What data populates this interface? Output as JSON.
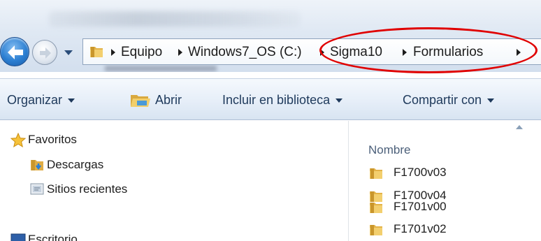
{
  "address_bar": {
    "crumbs": [
      "Equipo",
      "Windows7_OS (C:)",
      "Sigma10",
      "Formularios"
    ]
  },
  "toolbar": {
    "organize_label": "Organizar",
    "open_label": "Abrir",
    "include_label": "Incluir en biblioteca",
    "share_label": "Compartir con"
  },
  "nav_pane": {
    "favorites_label": "Favoritos",
    "items": [
      {
        "label": "Descargas",
        "icon": "downloads-icon"
      },
      {
        "label": "Sitios recientes",
        "icon": "recent-places-icon"
      },
      {
        "label": "Escritorio",
        "icon": "desktop-icon"
      }
    ]
  },
  "file_list": {
    "column_header": "Nombre",
    "files": [
      "F1700v03",
      "F1700v04",
      "F1701v00",
      "F1701v02"
    ]
  },
  "colors": {
    "highlight_ellipse": "#e00000",
    "command_text": "#1e395b",
    "folder": "#e8b84a"
  }
}
